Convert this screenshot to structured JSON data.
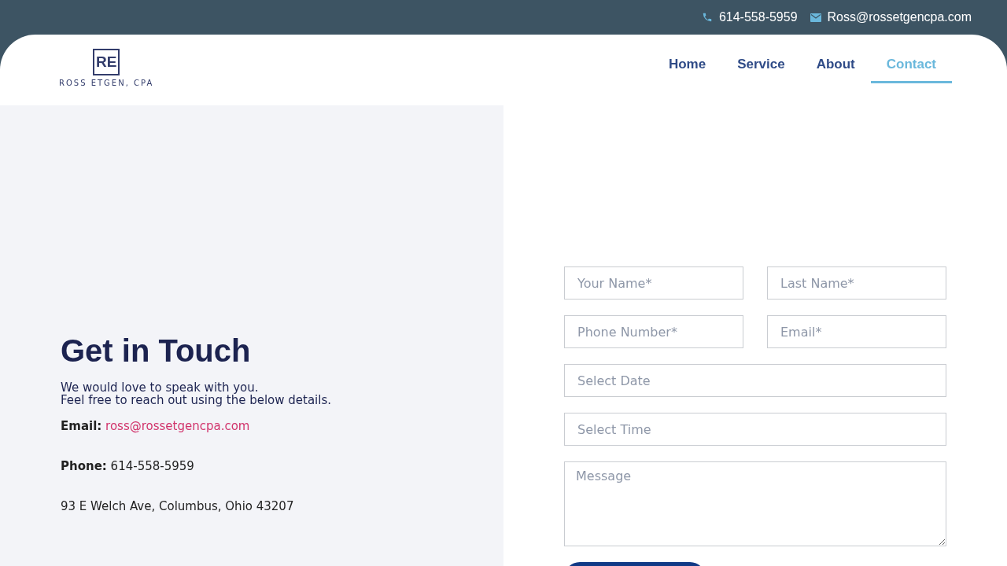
{
  "top_bar": {
    "phone": "614-558-5959",
    "email": "Ross@rossetgencpa.com"
  },
  "logo": {
    "mark": "RE",
    "name": "ROSS ETGEN, CPA"
  },
  "nav": [
    {
      "label": "Home",
      "selected": false
    },
    {
      "label": "Service",
      "selected": false
    },
    {
      "label": "About",
      "selected": false
    },
    {
      "label": "Contact",
      "selected": true
    }
  ],
  "contact": {
    "title": "Get in Touch",
    "intro": [
      "We would love to speak with you.",
      "Feel free to reach out using the below details."
    ],
    "email_label": "Email:",
    "email": "ross@rossetgencpa.com",
    "phone_label": "Phone:",
    "phone": "614-558-5959",
    "address": "93 E Welch Ave, Columbus, Ohio 43207"
  },
  "form": {
    "fields": [
      {
        "kind": "half",
        "placeholder": "Your Name*"
      },
      {
        "kind": "half",
        "placeholder": "Last Name*"
      },
      {
        "kind": "half",
        "placeholder": "Phone Number*"
      },
      {
        "kind": "half",
        "placeholder": "Email*"
      },
      {
        "kind": "full",
        "placeholder": "Select Date"
      },
      {
        "kind": "full",
        "placeholder": "Select Time"
      },
      {
        "kind": "textarea",
        "placeholder": "Message"
      }
    ]
  }
}
